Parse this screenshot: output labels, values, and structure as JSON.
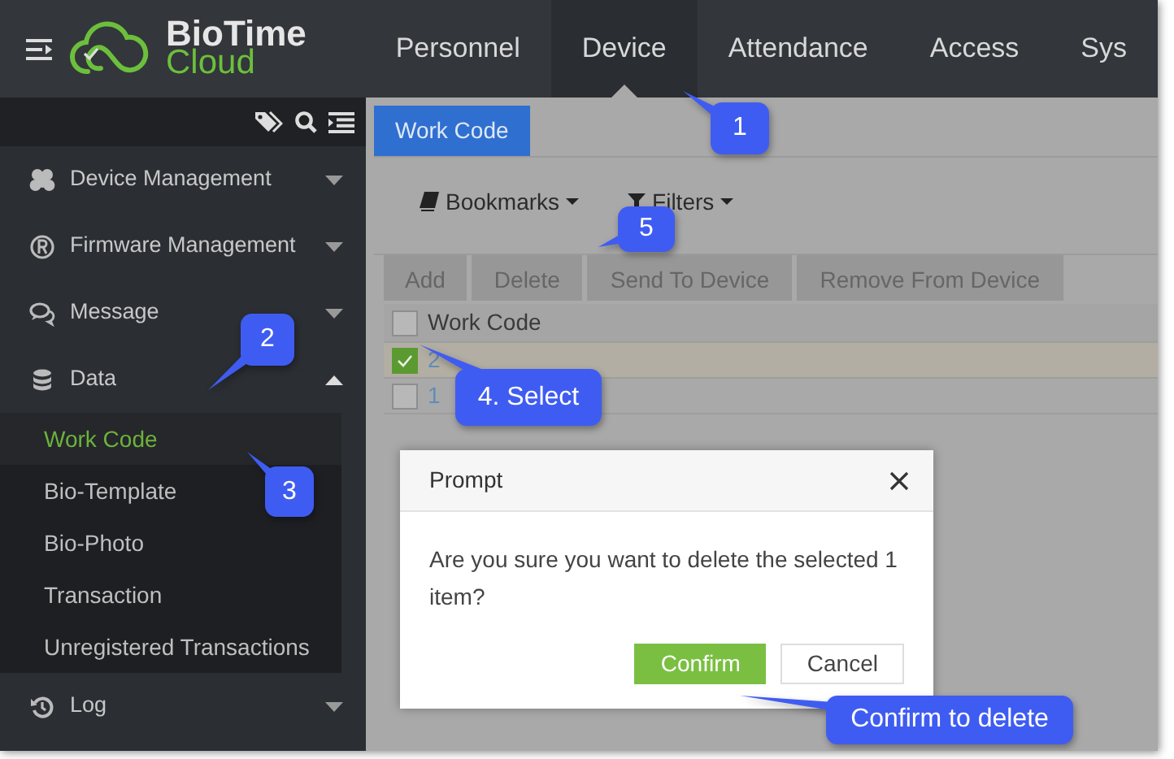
{
  "header": {
    "logo_title": "BioTime",
    "logo_subtitle": "Cloud",
    "nav": [
      {
        "label": "Personnel",
        "selected": false
      },
      {
        "label": "Device",
        "selected": true
      },
      {
        "label": "Attendance",
        "selected": false
      },
      {
        "label": "Access",
        "selected": false
      },
      {
        "label": "Sys",
        "selected": false
      }
    ]
  },
  "sidebar": {
    "items": [
      {
        "label": "Device Management",
        "expanded": false
      },
      {
        "label": "Firmware Management",
        "expanded": false
      },
      {
        "label": "Message",
        "expanded": false
      },
      {
        "label": "Data",
        "expanded": true,
        "children": [
          {
            "label": "Work Code",
            "selected": true
          },
          {
            "label": "Bio-Template",
            "selected": false
          },
          {
            "label": "Bio-Photo",
            "selected": false
          },
          {
            "label": "Transaction",
            "selected": false
          },
          {
            "label": "Unregistered Transactions",
            "selected": false
          }
        ]
      },
      {
        "label": "Log",
        "expanded": false
      }
    ]
  },
  "tabs": [
    {
      "label": "Work Code",
      "selected": true
    }
  ],
  "toolbar": [
    "Bookmarks",
    "Filters"
  ],
  "actions": [
    "Add",
    "Delete",
    "Send To Device",
    "Remove From Device"
  ],
  "table": {
    "columns": [
      "Work Code"
    ],
    "header_checked": false,
    "rows": [
      {
        "cells": [
          "2"
        ],
        "checked": true
      },
      {
        "cells": [
          "1"
        ],
        "checked": false
      }
    ]
  },
  "dialog": {
    "title": "Prompt",
    "message": "Are you sure you want to delete the selected 1 item?",
    "buttons": [
      {
        "label": "Confirm",
        "kind": "primary"
      },
      {
        "label": "Cancel",
        "kind": "secondary"
      }
    ]
  },
  "callouts": [
    "1",
    "2",
    "3",
    "4. Select",
    "5",
    "Confirm to delete"
  ]
}
